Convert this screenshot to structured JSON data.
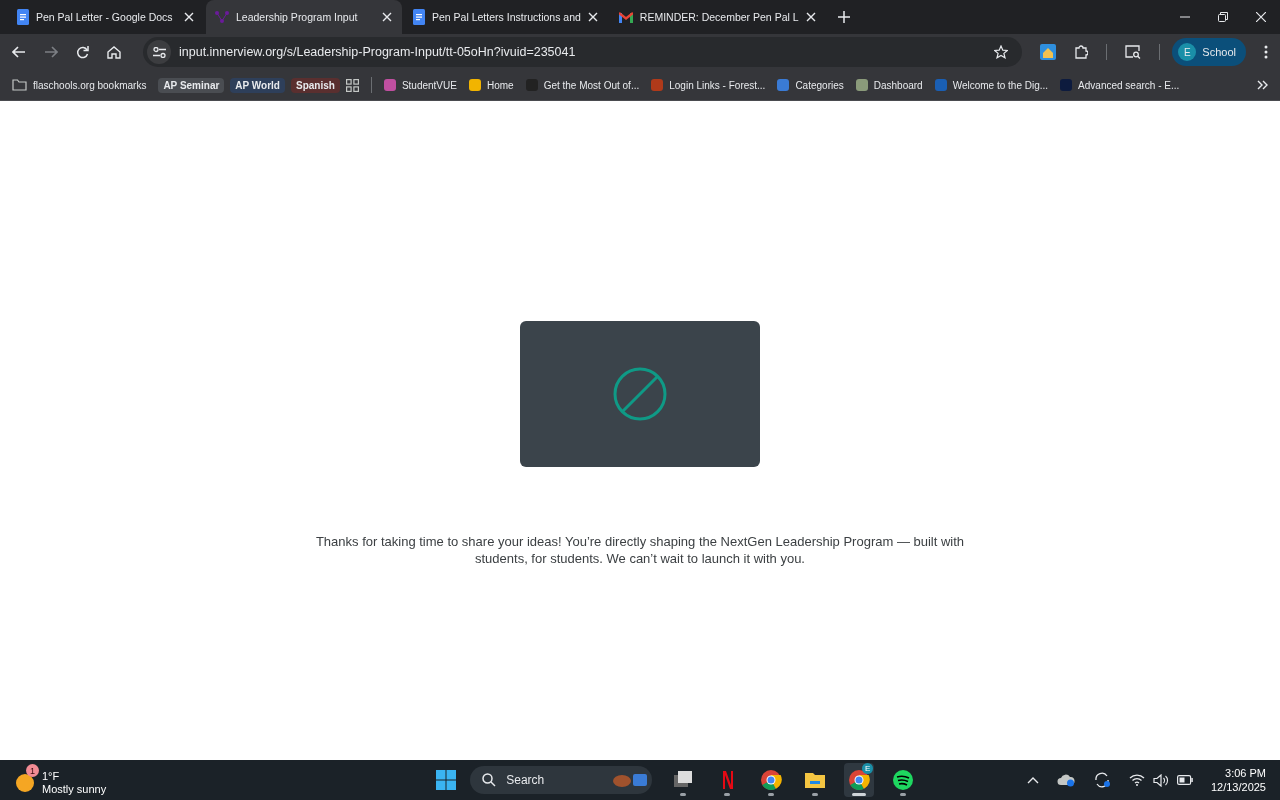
{
  "tabs": [
    {
      "title": "Pen Pal Letter - Google Docs",
      "kind": "docs",
      "selected": false
    },
    {
      "title": "Leadership Program Input",
      "kind": "innerview",
      "selected": true
    },
    {
      "title": "Pen Pal Letters Instructions and",
      "kind": "docs",
      "selected": false
    },
    {
      "title": "REMINDER: December Pen Pal L",
      "kind": "gmail",
      "selected": false
    }
  ],
  "address_bar": {
    "url": "input.innerview.org/s/Leadership-Program-Input/tt-05oHn?ivuid=235041"
  },
  "profile": {
    "initial": "E",
    "label": "School"
  },
  "bookmarks": [
    {
      "kind": "folder",
      "label": "flaschools.org bookmarks"
    },
    {
      "kind": "chip",
      "label": "AP Seminar",
      "color": "#4a4d52"
    },
    {
      "kind": "chip",
      "label": "AP World",
      "color": "#2e3f5a"
    },
    {
      "kind": "chip",
      "label": "Spanish",
      "color": "#5a2f2f"
    },
    {
      "kind": "apps"
    },
    {
      "kind": "separator"
    },
    {
      "kind": "link",
      "label": "StudentVUE",
      "color": "#c04fa0"
    },
    {
      "kind": "link",
      "label": "Home",
      "color": "#f2b400"
    },
    {
      "kind": "link",
      "label": "Get the Most Out of...",
      "color": "#222222"
    },
    {
      "kind": "link",
      "label": "Login Links - Forest...",
      "color": "#b03a1a"
    },
    {
      "kind": "link",
      "label": "Categories",
      "color": "#3a7bd5"
    },
    {
      "kind": "link",
      "label": "Dashboard",
      "color": "#8a9a7a"
    },
    {
      "kind": "link",
      "label": "Welcome to the Dig...",
      "color": "#1a5fb4"
    },
    {
      "kind": "link",
      "label": "Advanced search - E...",
      "color": "#0d1b3e"
    }
  ],
  "page": {
    "message": "Thanks for taking  time to share your ideas! You’re directly shaping the NextGen Leadership Program — built with students, for students. We can’t wait to launch it with you."
  },
  "taskbar": {
    "weather": {
      "temp": "1°F",
      "condition": "Mostly sunny",
      "badge": "1"
    },
    "search": {
      "placeholder": "Search"
    },
    "apps": [
      {
        "kind": "files-stack",
        "active": false
      },
      {
        "kind": "netflix",
        "active": false
      },
      {
        "kind": "chrome",
        "active": false
      },
      {
        "kind": "folder",
        "active": false
      },
      {
        "kind": "chrome",
        "active": true,
        "badge": "E"
      },
      {
        "kind": "spotify",
        "active": false
      }
    ],
    "time": "3:06 PM",
    "date": "12/13/2025"
  }
}
